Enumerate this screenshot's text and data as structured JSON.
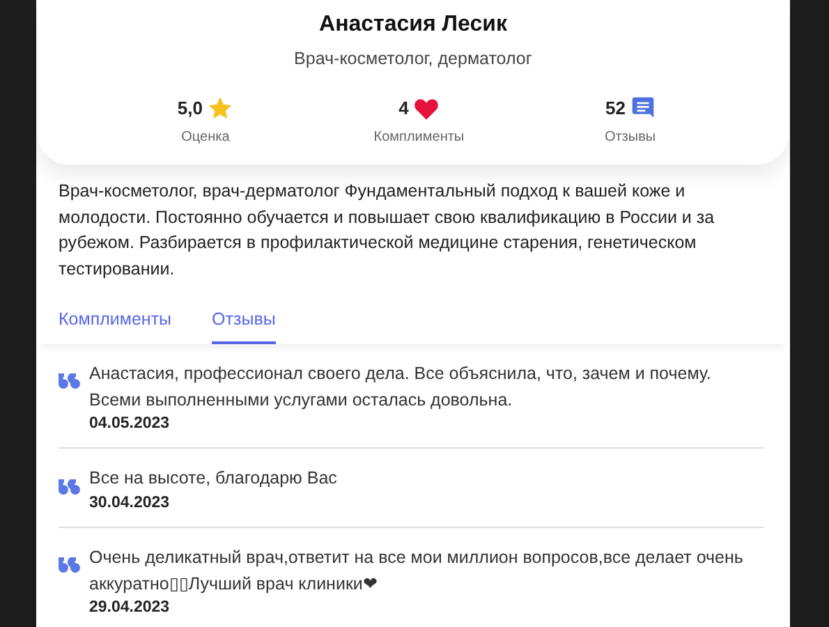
{
  "profile": {
    "name": "Анастасия Лесик",
    "specialty": "Врач-косметолог, дерматолог",
    "stats": [
      {
        "kind": "rating",
        "value": "5,0",
        "label": "Оценка"
      },
      {
        "kind": "compliments",
        "value": "4",
        "label": "Комплименты"
      },
      {
        "kind": "reviews",
        "value": "52",
        "label": "Отзывы"
      }
    ]
  },
  "description": "Врач-косметолог, врач-дерматолог Фундаментальный подход к вашей коже и молодости. Постоянно обучается и повышает свою квалификацию в России и за рубежом. Разбирается в профилактической медицине старения, генетическом тестировании.",
  "tabs": [
    {
      "label": "Комплименты",
      "selected": false
    },
    {
      "label": "Отзывы",
      "selected": true
    }
  ],
  "reviews": [
    {
      "text": "Анастасия, профессионал своего дела. Все объяснила, что, зачем и почему. Всеми выполненными услугами осталась довольна.",
      "date": "04.05.2023"
    },
    {
      "text": "Все на высоте, благодарю Вас",
      "date": "30.04.2023"
    },
    {
      "text": "Очень деликатный врач,ответит на все мои миллион вопросов,все делает очень аккуратно▯▯Лучший врач клиники❤",
      "date": "29.04.2023"
    }
  ]
}
